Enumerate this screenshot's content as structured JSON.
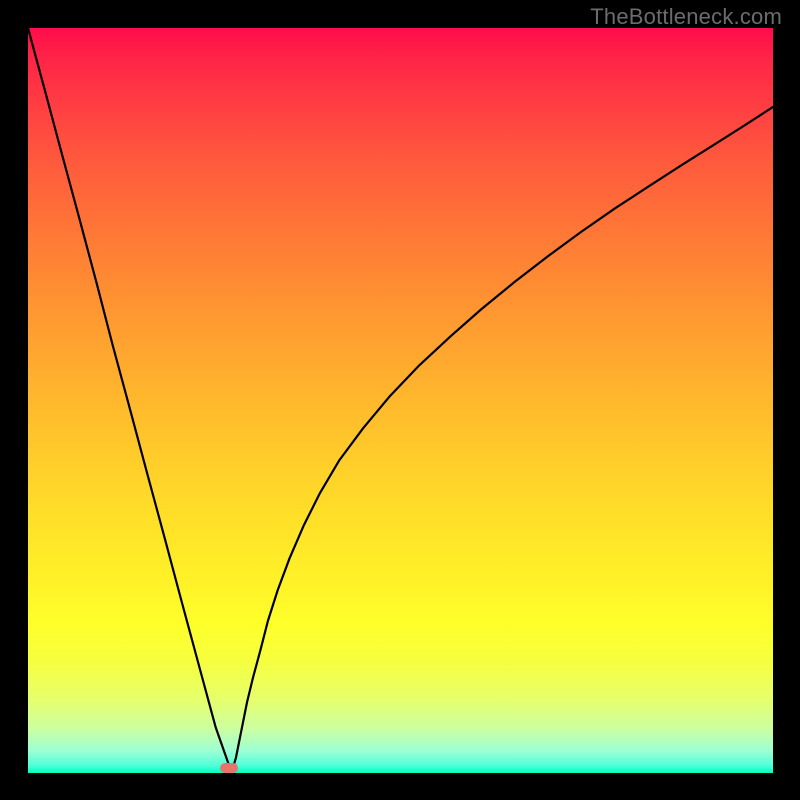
{
  "watermark": "TheBottleneck.com",
  "chart_data": {
    "type": "line",
    "title": "",
    "xlabel": "",
    "ylabel": "",
    "xlim": [
      0,
      100
    ],
    "ylim": [
      0,
      100
    ],
    "grid": false,
    "legend": null,
    "series": [
      {
        "name": "curve",
        "color": "#000000",
        "x": [
          0.0,
          2.3,
          4.6,
          6.9,
          9.2,
          11.4,
          13.7,
          16.0,
          18.3,
          20.6,
          22.9,
          25.2,
          27.1,
          27.5,
          27.9,
          28.3,
          28.8,
          29.4,
          30.2,
          31.2,
          32.2,
          33.5,
          35.1,
          37.0,
          39.2,
          41.8,
          45.0,
          48.5,
          52.4,
          56.7,
          60.9,
          65.3,
          69.7,
          74.2,
          78.8,
          83.4,
          87.9,
          92.2,
          96.3,
          100.0
        ],
        "values": [
          100.0,
          91.5,
          82.9,
          74.4,
          65.8,
          57.3,
          48.8,
          40.2,
          31.7,
          23.1,
          14.6,
          6.1,
          0.7,
          0.7,
          2.0,
          4.0,
          6.5,
          9.5,
          12.8,
          16.5,
          20.4,
          24.5,
          28.8,
          33.2,
          37.6,
          42.0,
          46.3,
          50.5,
          54.6,
          58.6,
          62.3,
          65.9,
          69.3,
          72.6,
          75.8,
          78.8,
          81.7,
          84.4,
          87.0,
          89.4
        ]
      }
    ],
    "min_marker": {
      "x_fraction": 0.27,
      "y_fraction": 0.007,
      "color": "#e7736b"
    }
  }
}
